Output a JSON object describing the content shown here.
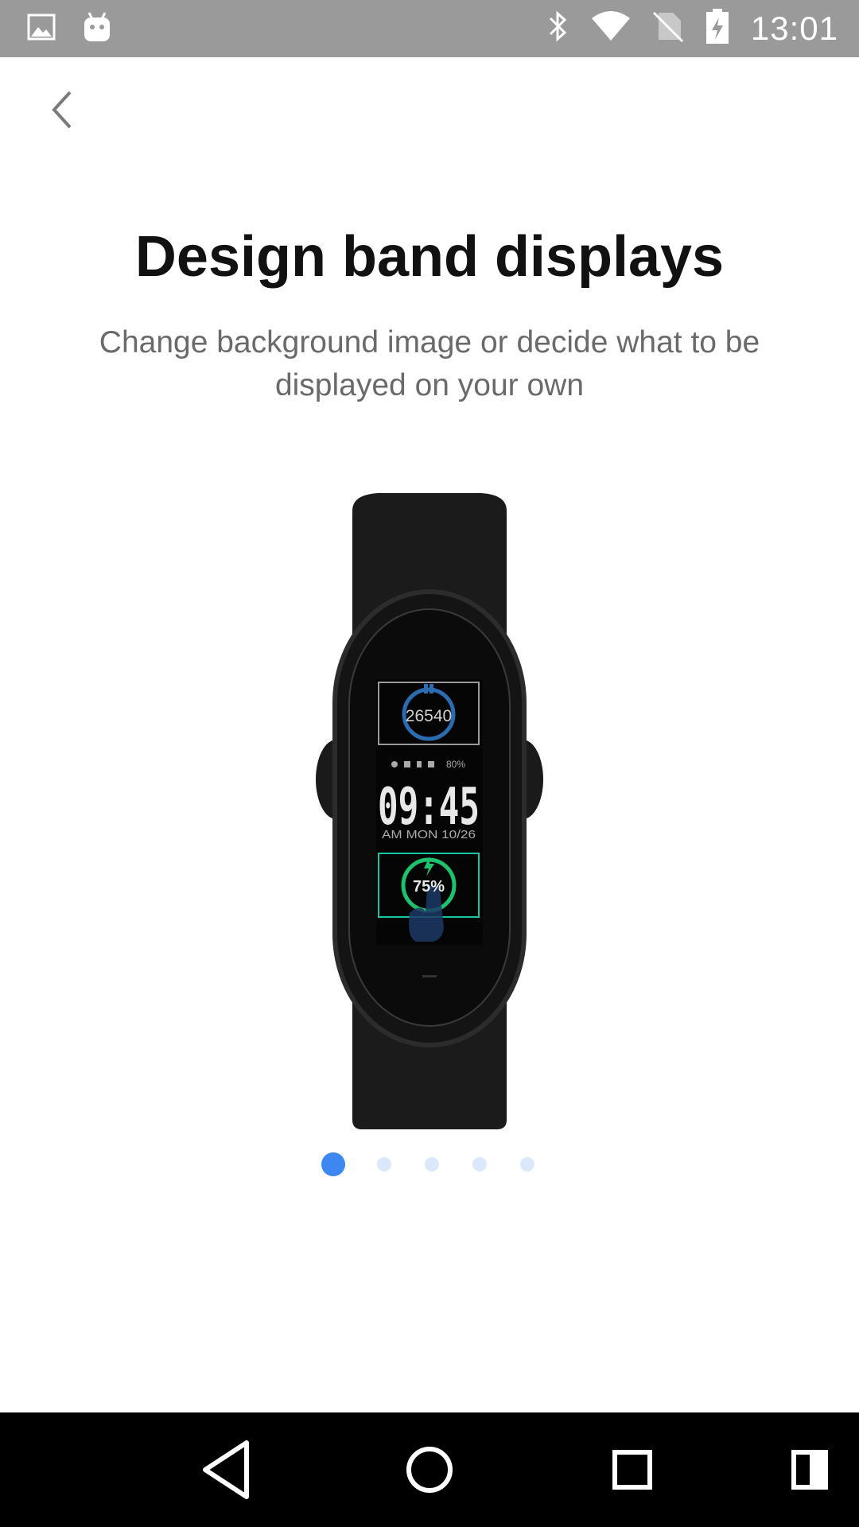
{
  "status_bar": {
    "time": "13:01",
    "icons": [
      "image-icon",
      "android-icon",
      "bluetooth-icon",
      "wifi-icon",
      "no-sim-icon",
      "battery-charging-icon"
    ]
  },
  "header": {
    "back_icon": "chevron-left-icon"
  },
  "onboarding": {
    "title": "Design band displays",
    "subtitle": "Change background image or decide what to be displayed on your own",
    "band_screen": {
      "steps": "26540",
      "time": "09:45",
      "date_line": "AM MON 10/26",
      "status_line": "80%",
      "battery": "75%"
    },
    "page_indicator": {
      "total": 5,
      "active_index": 0
    }
  },
  "nav_bar": {
    "icons": [
      "back-triangle-icon",
      "home-circle-icon",
      "recents-square-icon",
      "split-screen-icon"
    ]
  },
  "colors": {
    "status_bar_bg": "#9a9a9a",
    "accent_blue": "#3c87f0",
    "inactive_dot": "#dbe8fb",
    "title_text": "#111111",
    "subtitle_text": "#6a6a6a"
  }
}
